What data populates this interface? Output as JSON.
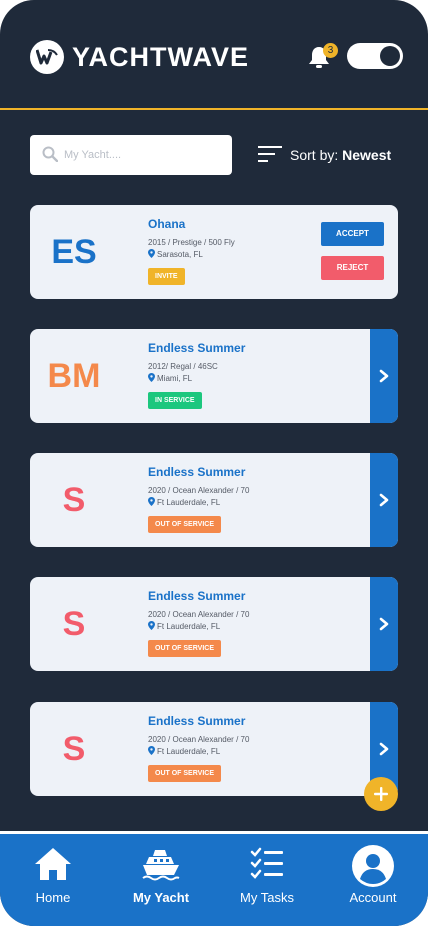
{
  "header": {
    "brand": "YACHTWAVE",
    "notification_count": "3",
    "toggle_on": true
  },
  "search": {
    "placeholder": "My Yacht....",
    "value": ""
  },
  "sort": {
    "label": "Sort by:",
    "value": "Newest"
  },
  "colors": {
    "background": "#1f2a3a",
    "accent_yellow": "#f0b429",
    "primary_blue": "#1a72c8",
    "initials_orange": "#f4894b",
    "initials_red": "#f25c6b",
    "status_green": "#1cc77e",
    "status_orange": "#f4894b"
  },
  "cards": [
    {
      "initials": "ES",
      "name": "Ohana",
      "details": "2015 / Prestige / 500 Fly",
      "location": "Sarasota, FL",
      "status": "INVITE",
      "accept_label": "ACCEPT",
      "reject_label": "REJECT"
    },
    {
      "initials": "BM",
      "name": "Endless Summer",
      "details": "2012/ Regal / 46SC",
      "location": "Miami, FL",
      "status": "IN SERVICE"
    },
    {
      "initials": "S",
      "name": "Endless Summer",
      "details": "2020 / Ocean Alexander / 70",
      "location": "Ft Lauderdale, FL",
      "status": "OUT OF SERVICE"
    },
    {
      "initials": "S",
      "name": "Endless Summer",
      "details": "2020 / Ocean Alexander / 70",
      "location": "Ft Lauderdale, FL",
      "status": "OUT OF SERVICE"
    },
    {
      "initials": "S",
      "name": "Endless Summer",
      "details": "2020 / Ocean Alexander / 70",
      "location": "Ft Lauderdale, FL",
      "status": "OUT OF SERVICE"
    }
  ],
  "nav": [
    {
      "label": "Home",
      "icon": "home-icon"
    },
    {
      "label": "My Yacht",
      "icon": "yacht-icon",
      "active": true
    },
    {
      "label": "My Tasks",
      "icon": "tasks-icon"
    },
    {
      "label": "Account",
      "icon": "account-icon"
    }
  ]
}
